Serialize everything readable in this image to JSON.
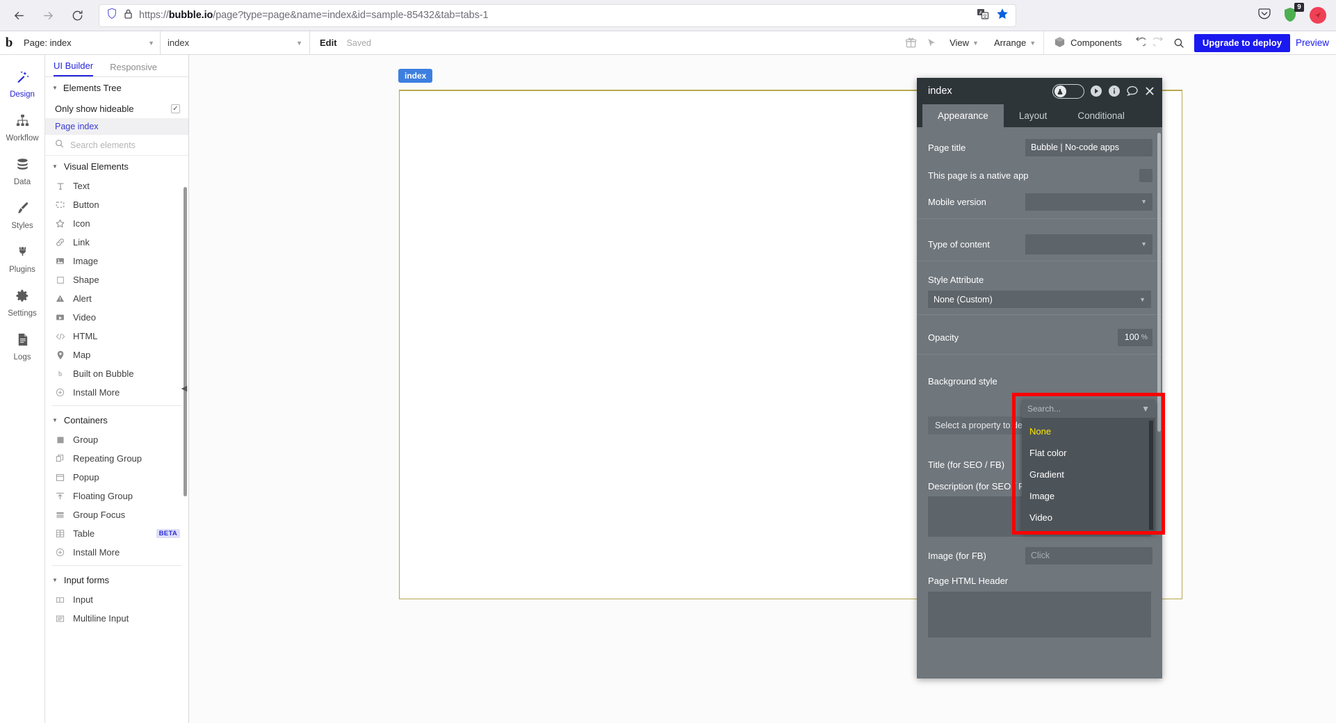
{
  "browser": {
    "url_prefix": "https://",
    "url_domain": "bubble.io",
    "url_rest": "/page?type=page&name=index&id=sample-85432&tab=tabs-1",
    "back_icon": "back-arrow-icon",
    "forward_icon": "forward-arrow-icon",
    "reload_icon": "reload-icon",
    "shield_icon": "tracking-shield-icon",
    "lock_icon": "lock-icon",
    "translate_icon": "translate-icon",
    "bookmark_icon": "bookmark-star-icon",
    "pocket_icon": "pocket-icon",
    "extension_badge": "9",
    "profile_icon": "profile-avatar-icon"
  },
  "topbar": {
    "logo": "b",
    "page_selector": "Page: index",
    "element_selector": "index",
    "edit_label": "Edit",
    "saved_label": "Saved",
    "gift_icon": "gift-icon",
    "cursor_icon": "cursor-icon",
    "view_label": "View",
    "arrange_label": "Arrange",
    "components_label": "Components",
    "components_icon": "cube-icon",
    "undo_icon": "undo-icon",
    "redo_icon": "redo-icon",
    "search_icon": "search-icon",
    "upgrade_label": "Upgrade to deploy",
    "preview_label": "Preview"
  },
  "rail": {
    "items": [
      {
        "label": "Design",
        "icon": "design-wand-icon",
        "active": true
      },
      {
        "label": "Workflow",
        "icon": "workflow-tree-icon",
        "active": false
      },
      {
        "label": "Data",
        "icon": "database-icon",
        "active": false
      },
      {
        "label": "Styles",
        "icon": "paintbrush-icon",
        "active": false
      },
      {
        "label": "Plugins",
        "icon": "plug-icon",
        "active": false
      },
      {
        "label": "Settings",
        "icon": "gear-icon",
        "active": false
      },
      {
        "label": "Logs",
        "icon": "logs-document-icon",
        "active": false
      }
    ]
  },
  "elements_panel": {
    "tabs": [
      {
        "label": "UI Builder",
        "active": true
      },
      {
        "label": "Responsive",
        "active": false
      }
    ],
    "tree_header": "Elements Tree",
    "only_show_hideable": "Only show hideable",
    "hideable_checked": true,
    "page_index": "Page index",
    "search_placeholder": "Search elements",
    "search_value": "",
    "sections": [
      {
        "title": "Visual Elements",
        "items": [
          {
            "label": "Text",
            "icon": "text-t-icon"
          },
          {
            "label": "Button",
            "icon": "button-icon"
          },
          {
            "label": "Icon",
            "icon": "star-icon"
          },
          {
            "label": "Link",
            "icon": "link-chain-icon"
          },
          {
            "label": "Image",
            "icon": "image-icon"
          },
          {
            "label": "Shape",
            "icon": "square-shape-icon"
          },
          {
            "label": "Alert",
            "icon": "alert-triangle-icon"
          },
          {
            "label": "Video",
            "icon": "video-play-icon"
          },
          {
            "label": "HTML",
            "icon": "code-brackets-icon"
          },
          {
            "label": "Map",
            "icon": "map-pin-icon"
          },
          {
            "label": "Built on Bubble",
            "icon": "bubble-b-icon"
          },
          {
            "label": "Install More",
            "icon": "plus-circle-icon"
          }
        ]
      },
      {
        "title": "Containers",
        "items": [
          {
            "label": "Group",
            "icon": "group-square-icon"
          },
          {
            "label": "Repeating Group",
            "icon": "repeating-group-icon"
          },
          {
            "label": "Popup",
            "icon": "popup-icon"
          },
          {
            "label": "Floating Group",
            "icon": "floating-group-icon"
          },
          {
            "label": "Group Focus",
            "icon": "group-focus-icon"
          },
          {
            "label": "Table",
            "icon": "table-grid-icon",
            "badge": "BETA"
          },
          {
            "label": "Install More",
            "icon": "plus-circle-icon"
          }
        ]
      },
      {
        "title": "Input forms",
        "items": [
          {
            "label": "Input",
            "icon": "input-field-icon"
          },
          {
            "label": "Multiline Input",
            "icon": "multiline-input-icon"
          }
        ]
      }
    ]
  },
  "canvas": {
    "page_tag": "index"
  },
  "property_editor": {
    "title": "index",
    "toggle_icon": "visibility-toggle-icon",
    "play_icon": "play-circle-icon",
    "info_icon": "info-circle-icon",
    "comment_icon": "comment-bubble-icon",
    "close_icon": "close-x-icon",
    "tabs": [
      {
        "label": "Appearance",
        "active": true
      },
      {
        "label": "Layout",
        "active": false
      },
      {
        "label": "Conditional",
        "active": false
      }
    ],
    "fields": {
      "page_title_label": "Page title",
      "page_title_value": "Bubble | No-code apps",
      "native_app_label": "This page is a native app",
      "native_app_checked": false,
      "mobile_version_label": "Mobile version",
      "mobile_version_value": "",
      "type_of_content_label": "Type of content",
      "type_of_content_value": "",
      "style_attribute_label": "Style Attribute",
      "style_attribute_value": "None (Custom)",
      "opacity_label": "Opacity",
      "opacity_value": "100",
      "opacity_unit": "%",
      "background_style_label": "Background style",
      "select_property_text": "Select a property to define",
      "title_seo_label": "Title (for SEO / FB)",
      "description_seo_label": "Description (for SEO / FB)",
      "image_fb_label": "Image (for FB)",
      "image_fb_placeholder": "Click",
      "page_html_header_label": "Page HTML Header"
    },
    "dropdown": {
      "search_placeholder": "Search...",
      "caret_icon": "chevron-down-icon",
      "options": [
        {
          "label": "None",
          "selected": true
        },
        {
          "label": "Flat color",
          "selected": false
        },
        {
          "label": "Gradient",
          "selected": false
        },
        {
          "label": "Image",
          "selected": false
        },
        {
          "label": "Video",
          "selected": false
        }
      ]
    }
  },
  "colors": {
    "accent_blue": "#2525d8",
    "upgrade_blue": "#1a1af0",
    "panel_dark": "#2e3539",
    "panel_body": "#6f767c",
    "highlight_red": "#ff0000",
    "selected_yellow": "#ffe800",
    "canvas_border": "#b9a94e",
    "tag_blue": "#3d7fe0"
  }
}
